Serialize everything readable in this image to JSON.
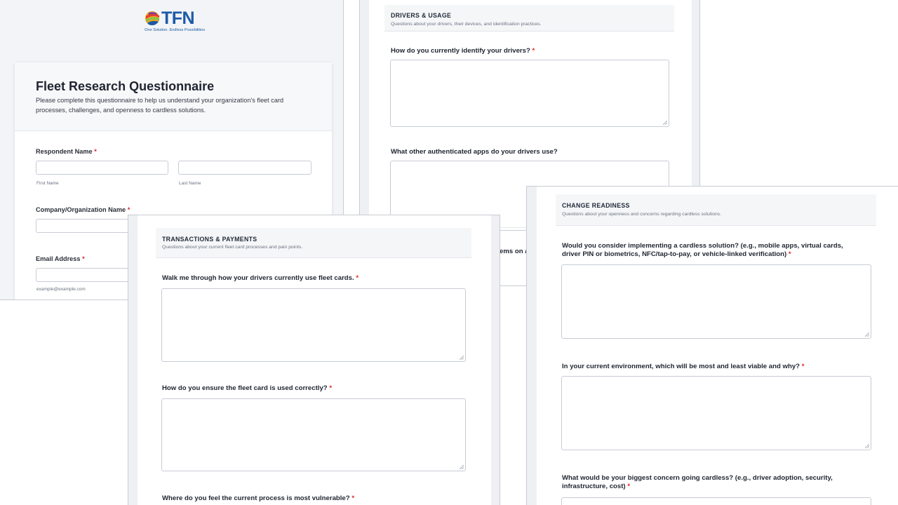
{
  "brand": {
    "name": "TFN",
    "tagline": "One Solution. Endless Possibilities"
  },
  "intro": {
    "title": "Fleet Research Questionnaire",
    "description": "Please complete this questionnaire to help us understand your organization's fleet card processes, challenges, and openness to cardless solutions.",
    "respondent_label": "Respondent Name",
    "first_name_sub": "First Name",
    "last_name_sub": "Last Name",
    "company_label": "Company/Organization Name",
    "email_label": "Email Address",
    "email_sub": "example@example.com",
    "required_mark": "*"
  },
  "drivers": {
    "title": "DRIVERS & USAGE",
    "desc": "Questions about your drivers, their devices, and identification practices.",
    "q1": "How do you currently identify your drivers?",
    "q2": "What other authenticated apps do your drivers use?",
    "peek_text": "ems on a"
  },
  "transactions": {
    "title": "TRANSACTIONS & PAYMENTS",
    "desc": "Questions about your current fleet card processes and pain points.",
    "q1": "Walk me through how your drivers currently use fleet cards.",
    "q2": "How do you ensure the fleet card is used correctly?",
    "q3": "Where do you feel the current process is most vulnerable?"
  },
  "readiness": {
    "title": "CHANGE READINESS",
    "desc": "Questions about your openness and concerns regarding cardless solutions.",
    "q1_line1": "Would you consider implementing a cardless solution? (e.g., mobile apps, virtual cards,",
    "q1_line2": "driver PIN or biometrics, NFC/tap-to-pay, or vehicle-linked verification)",
    "q2": "In your current environment, which will be most and least viable and why?",
    "q3_line1": "What would be your biggest concern going cardless? (e.g., driver adoption, security,",
    "q3_line2": "infrastructure, cost)"
  },
  "colors": {
    "accent_blue": "#1c5aa6",
    "required_red": "#dc2626"
  }
}
